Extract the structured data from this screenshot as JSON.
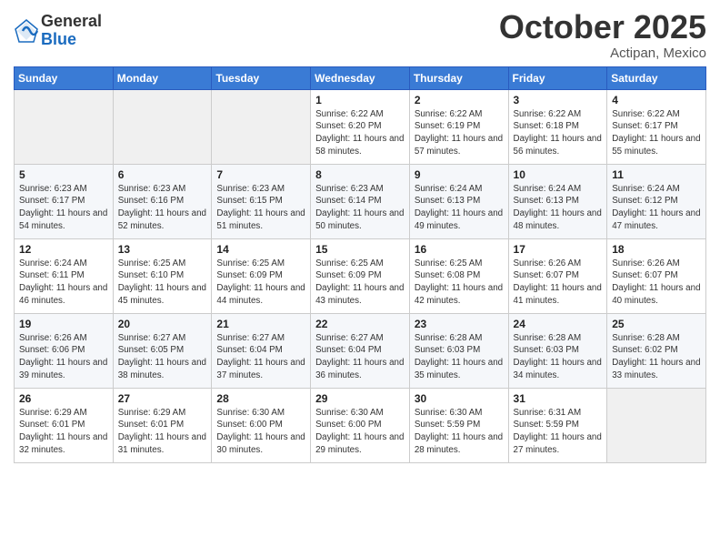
{
  "header": {
    "logo_general": "General",
    "logo_blue": "Blue",
    "month": "October 2025",
    "location": "Actipan, Mexico"
  },
  "days_of_week": [
    "Sunday",
    "Monday",
    "Tuesday",
    "Wednesday",
    "Thursday",
    "Friday",
    "Saturday"
  ],
  "weeks": [
    [
      {
        "day": "",
        "sunrise": "",
        "sunset": "",
        "daylight": ""
      },
      {
        "day": "",
        "sunrise": "",
        "sunset": "",
        "daylight": ""
      },
      {
        "day": "",
        "sunrise": "",
        "sunset": "",
        "daylight": ""
      },
      {
        "day": "1",
        "sunrise": "Sunrise: 6:22 AM",
        "sunset": "Sunset: 6:20 PM",
        "daylight": "Daylight: 11 hours and 58 minutes."
      },
      {
        "day": "2",
        "sunrise": "Sunrise: 6:22 AM",
        "sunset": "Sunset: 6:19 PM",
        "daylight": "Daylight: 11 hours and 57 minutes."
      },
      {
        "day": "3",
        "sunrise": "Sunrise: 6:22 AM",
        "sunset": "Sunset: 6:18 PM",
        "daylight": "Daylight: 11 hours and 56 minutes."
      },
      {
        "day": "4",
        "sunrise": "Sunrise: 6:22 AM",
        "sunset": "Sunset: 6:17 PM",
        "daylight": "Daylight: 11 hours and 55 minutes."
      }
    ],
    [
      {
        "day": "5",
        "sunrise": "Sunrise: 6:23 AM",
        "sunset": "Sunset: 6:17 PM",
        "daylight": "Daylight: 11 hours and 54 minutes."
      },
      {
        "day": "6",
        "sunrise": "Sunrise: 6:23 AM",
        "sunset": "Sunset: 6:16 PM",
        "daylight": "Daylight: 11 hours and 52 minutes."
      },
      {
        "day": "7",
        "sunrise": "Sunrise: 6:23 AM",
        "sunset": "Sunset: 6:15 PM",
        "daylight": "Daylight: 11 hours and 51 minutes."
      },
      {
        "day": "8",
        "sunrise": "Sunrise: 6:23 AM",
        "sunset": "Sunset: 6:14 PM",
        "daylight": "Daylight: 11 hours and 50 minutes."
      },
      {
        "day": "9",
        "sunrise": "Sunrise: 6:24 AM",
        "sunset": "Sunset: 6:13 PM",
        "daylight": "Daylight: 11 hours and 49 minutes."
      },
      {
        "day": "10",
        "sunrise": "Sunrise: 6:24 AM",
        "sunset": "Sunset: 6:13 PM",
        "daylight": "Daylight: 11 hours and 48 minutes."
      },
      {
        "day": "11",
        "sunrise": "Sunrise: 6:24 AM",
        "sunset": "Sunset: 6:12 PM",
        "daylight": "Daylight: 11 hours and 47 minutes."
      }
    ],
    [
      {
        "day": "12",
        "sunrise": "Sunrise: 6:24 AM",
        "sunset": "Sunset: 6:11 PM",
        "daylight": "Daylight: 11 hours and 46 minutes."
      },
      {
        "day": "13",
        "sunrise": "Sunrise: 6:25 AM",
        "sunset": "Sunset: 6:10 PM",
        "daylight": "Daylight: 11 hours and 45 minutes."
      },
      {
        "day": "14",
        "sunrise": "Sunrise: 6:25 AM",
        "sunset": "Sunset: 6:09 PM",
        "daylight": "Daylight: 11 hours and 44 minutes."
      },
      {
        "day": "15",
        "sunrise": "Sunrise: 6:25 AM",
        "sunset": "Sunset: 6:09 PM",
        "daylight": "Daylight: 11 hours and 43 minutes."
      },
      {
        "day": "16",
        "sunrise": "Sunrise: 6:25 AM",
        "sunset": "Sunset: 6:08 PM",
        "daylight": "Daylight: 11 hours and 42 minutes."
      },
      {
        "day": "17",
        "sunrise": "Sunrise: 6:26 AM",
        "sunset": "Sunset: 6:07 PM",
        "daylight": "Daylight: 11 hours and 41 minutes."
      },
      {
        "day": "18",
        "sunrise": "Sunrise: 6:26 AM",
        "sunset": "Sunset: 6:07 PM",
        "daylight": "Daylight: 11 hours and 40 minutes."
      }
    ],
    [
      {
        "day": "19",
        "sunrise": "Sunrise: 6:26 AM",
        "sunset": "Sunset: 6:06 PM",
        "daylight": "Daylight: 11 hours and 39 minutes."
      },
      {
        "day": "20",
        "sunrise": "Sunrise: 6:27 AM",
        "sunset": "Sunset: 6:05 PM",
        "daylight": "Daylight: 11 hours and 38 minutes."
      },
      {
        "day": "21",
        "sunrise": "Sunrise: 6:27 AM",
        "sunset": "Sunset: 6:04 PM",
        "daylight": "Daylight: 11 hours and 37 minutes."
      },
      {
        "day": "22",
        "sunrise": "Sunrise: 6:27 AM",
        "sunset": "Sunset: 6:04 PM",
        "daylight": "Daylight: 11 hours and 36 minutes."
      },
      {
        "day": "23",
        "sunrise": "Sunrise: 6:28 AM",
        "sunset": "Sunset: 6:03 PM",
        "daylight": "Daylight: 11 hours and 35 minutes."
      },
      {
        "day": "24",
        "sunrise": "Sunrise: 6:28 AM",
        "sunset": "Sunset: 6:03 PM",
        "daylight": "Daylight: 11 hours and 34 minutes."
      },
      {
        "day": "25",
        "sunrise": "Sunrise: 6:28 AM",
        "sunset": "Sunset: 6:02 PM",
        "daylight": "Daylight: 11 hours and 33 minutes."
      }
    ],
    [
      {
        "day": "26",
        "sunrise": "Sunrise: 6:29 AM",
        "sunset": "Sunset: 6:01 PM",
        "daylight": "Daylight: 11 hours and 32 minutes."
      },
      {
        "day": "27",
        "sunrise": "Sunrise: 6:29 AM",
        "sunset": "Sunset: 6:01 PM",
        "daylight": "Daylight: 11 hours and 31 minutes."
      },
      {
        "day": "28",
        "sunrise": "Sunrise: 6:30 AM",
        "sunset": "Sunset: 6:00 PM",
        "daylight": "Daylight: 11 hours and 30 minutes."
      },
      {
        "day": "29",
        "sunrise": "Sunrise: 6:30 AM",
        "sunset": "Sunset: 6:00 PM",
        "daylight": "Daylight: 11 hours and 29 minutes."
      },
      {
        "day": "30",
        "sunrise": "Sunrise: 6:30 AM",
        "sunset": "Sunset: 5:59 PM",
        "daylight": "Daylight: 11 hours and 28 minutes."
      },
      {
        "day": "31",
        "sunrise": "Sunrise: 6:31 AM",
        "sunset": "Sunset: 5:59 PM",
        "daylight": "Daylight: 11 hours and 27 minutes."
      },
      {
        "day": "",
        "sunrise": "",
        "sunset": "",
        "daylight": ""
      }
    ]
  ]
}
